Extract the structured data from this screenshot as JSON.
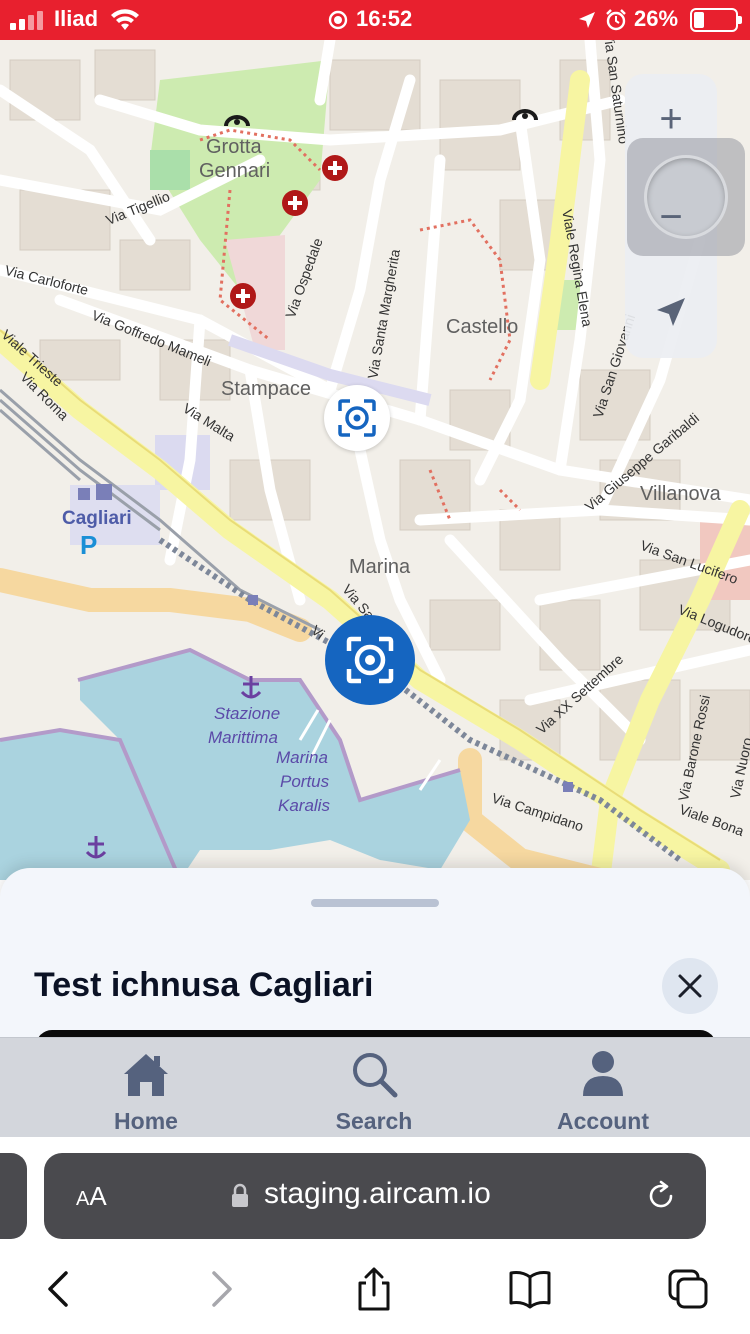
{
  "status_bar": {
    "carrier": "Iliad",
    "time": "16:52",
    "battery_percent": "26%",
    "battery_level": 0.26,
    "background_color": "#e8202e"
  },
  "map": {
    "places": [
      "Grotta\nGennari",
      "Castello",
      "Stampace",
      "Villanova",
      "Marina"
    ],
    "place_grotta_line1": "Grotta",
    "place_grotta_line2": "Gennari",
    "place_castello": "Castello",
    "place_stampace": "Stampace",
    "place_villanova": "Villanova",
    "place_marina": "Marina",
    "streets": {
      "via_tigellio": "Via Tigellio",
      "via_carloforte": "Via Carloforte",
      "via_goffredo_mameli": "Via Goffredo Mameli",
      "via_ospedale": "Via Ospedale",
      "via_santa_margherita": "Via Santa Margherita",
      "viale_regina_elena": "Viale Regina Elena",
      "via_san_giovanni": "Via San Giovanni",
      "viale_trieste": "Viale Trieste",
      "via_roma": "Via Roma",
      "via_malta": "Via Malta",
      "via_san_saturnino": "Via San Saturnino",
      "via_giuseppe_garibaldi": "Via Giuseppe Garibaldi",
      "via_san_lucifero": "Via San Lucifero",
      "via_logudoro": "Via Logudoro",
      "via_xx_settembre": "Via XX Settembre",
      "via_barone_rossi": "Via Barone Rossi",
      "via_nuoro": "Via Nuoro",
      "viale_bonaria": "Viale Bona",
      "via_campidano": "Via Campidano",
      "via_sa": "Via Sa",
      "via_v": "Vi"
    },
    "station_label": "Cagliari",
    "parking_label": "P",
    "water_labels": {
      "stazione_line1": "Stazione",
      "stazione_line2": "Marittima",
      "marina_line1": "Marina",
      "marina_line2": "Portus",
      "marina_line3": "Karalis"
    },
    "controls": {
      "zoom_in": "+",
      "zoom_out": "−"
    },
    "marker_color": "#1565c0"
  },
  "sheet": {
    "title": "Test ichnusa Cagliari"
  },
  "tabbar": {
    "tabs": [
      {
        "label": "Home",
        "icon": "home-icon"
      },
      {
        "label": "Search",
        "icon": "search-icon"
      },
      {
        "label": "Account",
        "icon": "account-icon"
      }
    ],
    "accent_color": "#55627e"
  },
  "browser": {
    "text_size_label_large": "A",
    "text_size_label_small": "A",
    "url": "staging.aircam.io"
  }
}
